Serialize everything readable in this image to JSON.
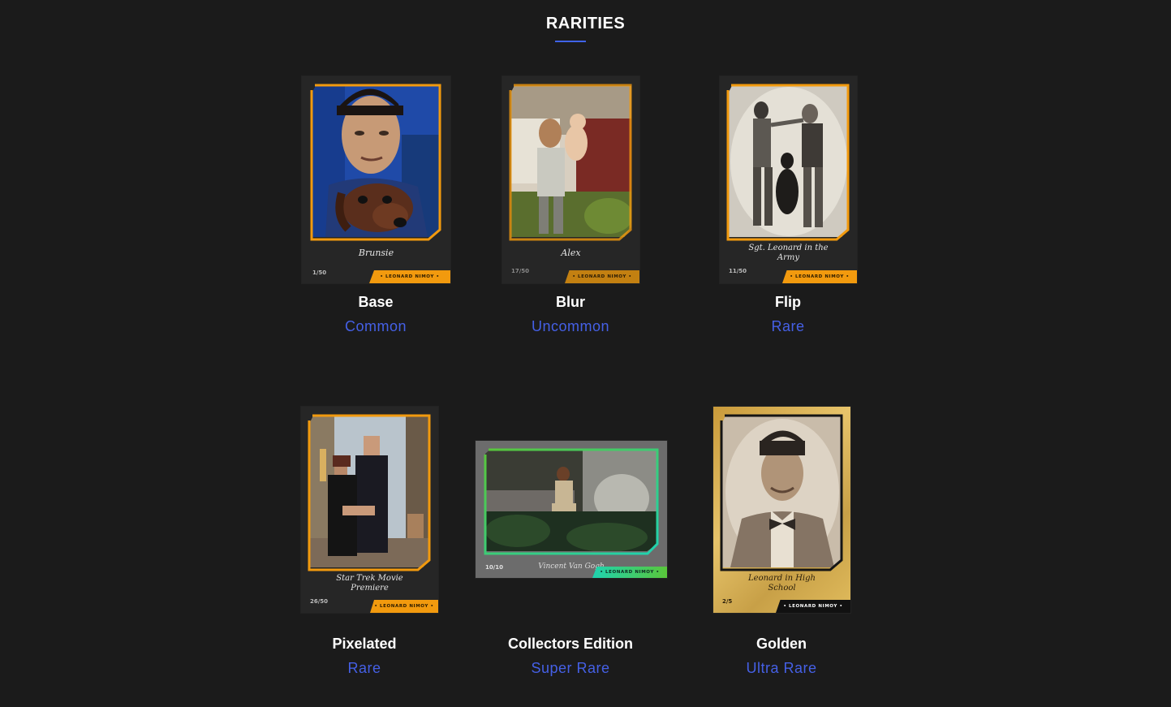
{
  "section": {
    "title": "RARITIES"
  },
  "cards": [
    {
      "name": "Base",
      "rarity": "Common",
      "caption": "Brunsie",
      "serial": "1/50",
      "brand": "• LEONARD NIMOY •"
    },
    {
      "name": "Blur",
      "rarity": "Uncommon",
      "caption": "Alex",
      "serial": "17/50",
      "brand": "• LEONARD NIMOY •"
    },
    {
      "name": "Flip",
      "rarity": "Rare",
      "caption": "Sgt. Leonard in the Army",
      "serial": "11/50",
      "brand": "• LEONARD NIMOY •"
    },
    {
      "name": "Pixelated",
      "rarity": "Rare",
      "caption": "Star Trek Movie Premiere",
      "serial": "26/50",
      "brand": "• LEONARD NIMOY •"
    },
    {
      "name": "Collectors Edition",
      "rarity": "Super Rare",
      "caption": "Vincent Van Gogh",
      "serial": "10/10",
      "brand": "• LEONARD NIMOY •"
    },
    {
      "name": "Golden",
      "rarity": "Ultra Rare",
      "caption": "Leonard in High School",
      "serial": "2/5",
      "brand": "• LEONARD NIMOY •"
    }
  ],
  "colors": {
    "background": "#1b1b1b",
    "accent_blue": "#4560e6",
    "frame_orange": "#f29a0e",
    "frame_teal": "#1fd3b0",
    "frame_green": "#59c63a",
    "gold": "#d9b24a"
  }
}
